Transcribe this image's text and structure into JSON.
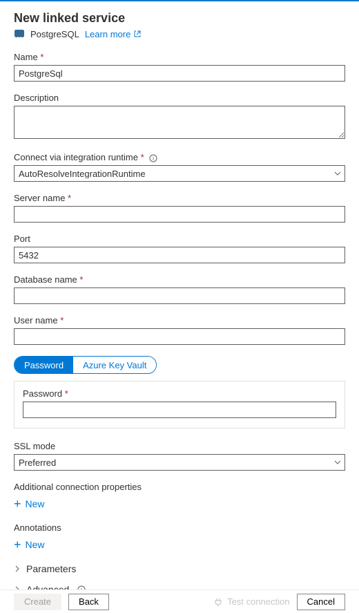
{
  "header": {
    "title": "New linked service",
    "connector": "PostgreSQL",
    "learn_more": "Learn more"
  },
  "fields": {
    "name": {
      "label": "Name",
      "value": "PostgreSql",
      "required": true
    },
    "description": {
      "label": "Description",
      "value": ""
    },
    "runtime": {
      "label": "Connect via integration runtime",
      "required": true,
      "selected": "AutoResolveIntegrationRuntime"
    },
    "server": {
      "label": "Server name",
      "required": true,
      "value": ""
    },
    "port": {
      "label": "Port",
      "value": "5432"
    },
    "database": {
      "label": "Database name",
      "required": true,
      "value": ""
    },
    "username": {
      "label": "User name",
      "required": true,
      "value": ""
    },
    "password_tab": {
      "option1": "Password",
      "option2": "Azure Key Vault"
    },
    "password": {
      "label": "Password",
      "required": true,
      "value": ""
    },
    "sslmode": {
      "label": "SSL mode",
      "selected": "Preferred"
    }
  },
  "sections": {
    "addprops": {
      "label": "Additional connection properties",
      "new": "New"
    },
    "annotations": {
      "label": "Annotations",
      "new": "New"
    },
    "parameters": "Parameters",
    "advanced": "Advanced"
  },
  "footer": {
    "create": "Create",
    "back": "Back",
    "test": "Test connection",
    "cancel": "Cancel"
  }
}
